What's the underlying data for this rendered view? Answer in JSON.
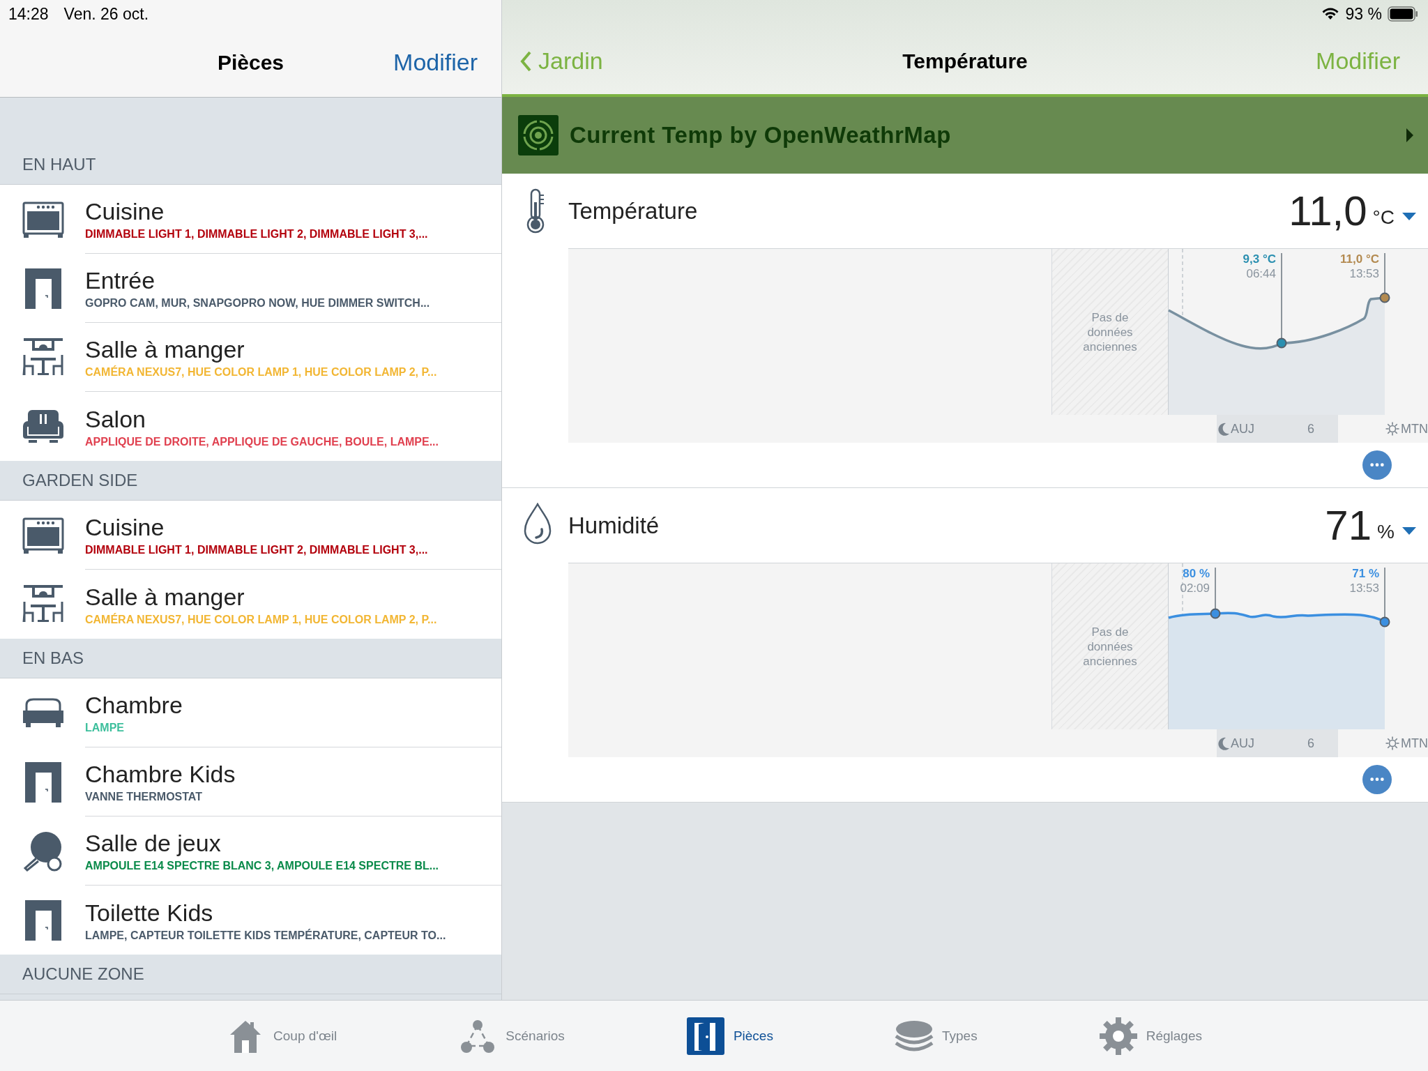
{
  "status_bar": {
    "time": "14:28",
    "date": "Ven. 26 oct.",
    "battery": "93 %"
  },
  "rooms_panel": {
    "title": "Pièces",
    "edit": "Modifier",
    "sections": [
      {
        "title": "EN HAUT",
        "rooms": [
          {
            "name": "Cuisine",
            "devices": "DIMMABLE LIGHT 1, DIMMABLE LIGHT 2, DIMMABLE LIGHT 3,...",
            "color": "#b3000c",
            "kind": "oven"
          },
          {
            "name": "Entrée",
            "devices": "GOPRO CAM, MUR, SNAPGOPRO NOW, HUE DIMMER SWITCH...",
            "color": "#4a5a6a",
            "kind": "door"
          },
          {
            "name": "Salle à manger",
            "devices": "CAMÉRA NEXUS7, HUE COLOR LAMP 1, HUE COLOR LAMP 2, P...",
            "color": "#f2b633",
            "kind": "dining"
          },
          {
            "name": "Salon",
            "devices": "APPLIQUE DE DROITE, APPLIQUE DE GAUCHE, BOULE, LAMPE...",
            "color": "#e0404f",
            "kind": "armchair"
          }
        ]
      },
      {
        "title": "GARDEN SIDE",
        "rooms": [
          {
            "name": "Cuisine",
            "devices": "DIMMABLE LIGHT 1, DIMMABLE LIGHT 2, DIMMABLE LIGHT 3,...",
            "color": "#b3000c",
            "kind": "oven"
          },
          {
            "name": "Salle à manger",
            "devices": "CAMÉRA NEXUS7, HUE COLOR LAMP 1, HUE COLOR LAMP 2, P...",
            "color": "#f2b633",
            "kind": "dining"
          }
        ]
      },
      {
        "title": "EN BAS",
        "rooms": [
          {
            "name": "Chambre",
            "devices": "LAMPE",
            "color": "#3cbf9c",
            "kind": "bed"
          },
          {
            "name": "Chambre Kids",
            "devices": "VANNE THERMOSTAT",
            "color": "#4a5a6a",
            "kind": "door"
          },
          {
            "name": "Salle de jeux",
            "devices": "AMPOULE E14 SPECTRE BLANC 3, AMPOULE E14 SPECTRE BL...",
            "color": "#0a8a4a",
            "kind": "pingpong"
          },
          {
            "name": "Toilette Kids",
            "devices": "LAMPE, CAPTEUR TOILETTE KIDS TEMPÉRATURE, CAPTEUR TO...",
            "color": "#4a5a6a",
            "kind": "door"
          }
        ]
      },
      {
        "title": "AUCUNE ZONE"
      }
    ]
  },
  "detail": {
    "back": "Jardin",
    "title": "Température",
    "edit": "Modifier",
    "device": "Current Temp by OpenWeathrMap",
    "sensors": [
      {
        "kind": "temperature",
        "name": "Température",
        "value": "11,0",
        "unit": "°C",
        "no_data": "Pas de données anciennes",
        "markers": [
          {
            "value": "9,3 °C",
            "time": "06:44",
            "color": "#2a8fb0"
          },
          {
            "value": "11,0 °C",
            "time": "13:53",
            "color": "#b38a50"
          }
        ],
        "axis": [
          "AUJ",
          "6",
          "MTN"
        ]
      },
      {
        "kind": "humidity",
        "name": "Humidité",
        "value": "71",
        "unit": "%",
        "no_data": "Pas de données anciennes",
        "markers": [
          {
            "value": "80 %",
            "time": "02:09",
            "color": "#3b8fe0"
          },
          {
            "value": "71 %",
            "time": "13:53",
            "color": "#3b8fe0"
          }
        ],
        "axis": [
          "AUJ",
          "6",
          "MTN"
        ]
      }
    ]
  },
  "tabs": [
    {
      "label": "Coup d'œil",
      "kind": "home",
      "selected": false
    },
    {
      "label": "Scénarios",
      "kind": "scenes",
      "selected": false
    },
    {
      "label": "Pièces",
      "kind": "rooms",
      "selected": true
    },
    {
      "label": "Types",
      "kind": "types",
      "selected": false
    },
    {
      "label": "Réglages",
      "kind": "settings",
      "selected": false
    }
  ]
}
